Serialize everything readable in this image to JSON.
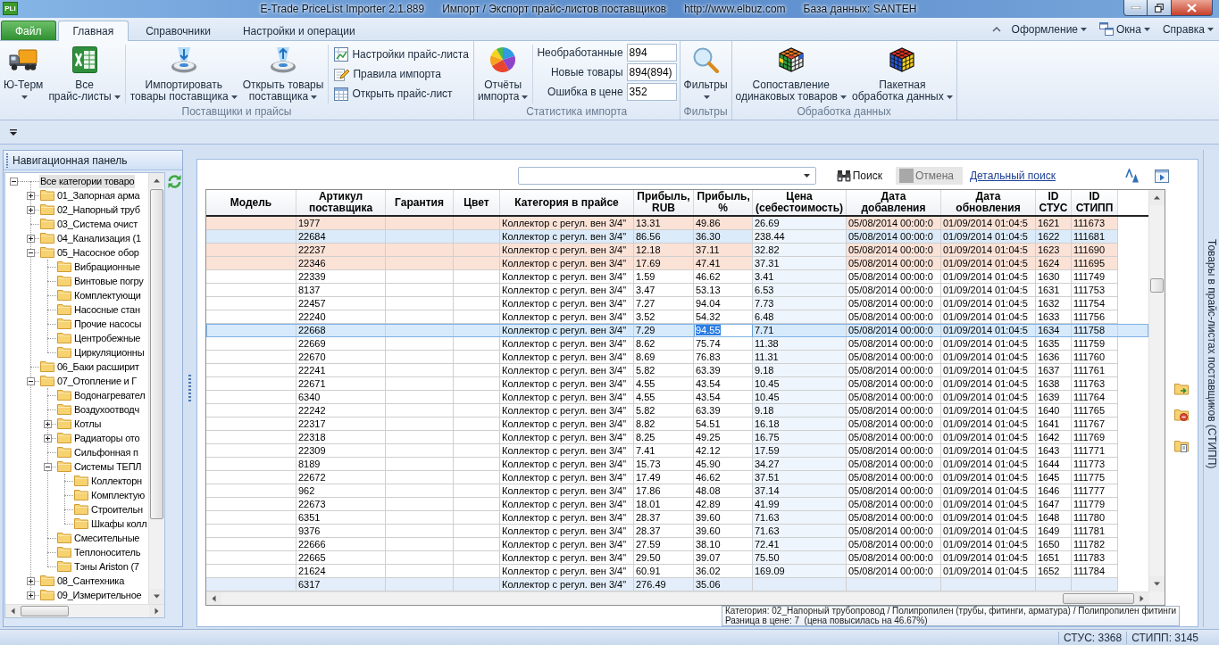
{
  "window": {
    "icon_text": "PLi",
    "title_parts": [
      "E-Trade PriceList Importer 2.1.889",
      "Импорт / Экспорт прайс-листов поставщиков",
      "http://www.elbuz.com",
      "База данных: SANTEH"
    ]
  },
  "ribbon": {
    "file_tab": "Файл",
    "tabs": [
      {
        "label": "Главная",
        "selected": true
      },
      {
        "label": "Справочники",
        "selected": false
      },
      {
        "label": "Настройки и операции",
        "selected": false
      }
    ],
    "menus": [
      {
        "label": "Оформление"
      },
      {
        "label": "Окна"
      },
      {
        "label": "Справка"
      }
    ],
    "groups": [
      {
        "label": "Поставщики и прайсы",
        "sections": [
          {
            "kind": "large",
            "buttons": [
              {
                "lines": [
                  "Ю-Терм"
                ],
                "dropdown": true
              },
              {
                "lines": [
                  "Все",
                  "прайс-листы"
                ],
                "dropdown": true
              }
            ]
          },
          {
            "kind": "large",
            "buttons": [
              {
                "lines": [
                  "Импортировать",
                  "товары поставщика"
                ],
                "dropdown": true
              },
              {
                "lines": [
                  "Открыть товары",
                  "поставщика"
                ],
                "dropdown": true
              }
            ]
          },
          {
            "kind": "small",
            "buttons": [
              "Настройки прайс-листа",
              "Правила импорта",
              "Открыть прайс-лист"
            ]
          }
        ]
      },
      {
        "label": "Статистика импорта",
        "sections": [
          {
            "kind": "large",
            "buttons": [
              {
                "lines": [
                  "Отчёты",
                  "импорта"
                ],
                "dropdown": true
              }
            ]
          },
          {
            "kind": "stats",
            "items": [
              {
                "label": "Необработанные",
                "value": "894"
              },
              {
                "label": "Новые товары",
                "value": "894(894)"
              },
              {
                "label": "Ошибка в цене",
                "value": "352"
              }
            ]
          }
        ]
      },
      {
        "label": "Фильтры",
        "sections": [
          {
            "kind": "large",
            "buttons": [
              {
                "lines": [
                  "Фильтры"
                ],
                "dropdown": true
              }
            ]
          }
        ]
      },
      {
        "label": "Обработка данных",
        "sections": [
          {
            "kind": "large",
            "buttons": [
              {
                "lines": [
                  "Сопоставление",
                  "одинаковых товаров"
                ],
                "dropdown": true
              },
              {
                "lines": [
                  "Пакетная",
                  "обработка данных"
                ],
                "dropdown": true
              }
            ]
          }
        ]
      }
    ]
  },
  "nav_panel": {
    "title": "Навигационная панель",
    "tree": [
      {
        "label": "Все категории товаро",
        "selected": true,
        "expanded": true,
        "children": [
          {
            "label": "01_Запорная арма",
            "selected": false,
            "expanded": false
          },
          {
            "label": "02_Напорный труб",
            "selected": false,
            "expanded": false
          },
          {
            "label": "03_Система очист",
            "selected": false
          },
          {
            "label": "04_Канализация (1",
            "selected": false,
            "expanded": false
          },
          {
            "label": "05_Насосное обор",
            "selected": false,
            "expanded": true,
            "children": [
              {
                "label": "Вибрационные",
                "selected": false
              },
              {
                "label": "Винтовые погру",
                "selected": false
              },
              {
                "label": "Комплектующи",
                "selected": false
              },
              {
                "label": "Насосные стан",
                "selected": false
              },
              {
                "label": "Прочие насосы",
                "selected": false
              },
              {
                "label": "Центробежные",
                "selected": false
              },
              {
                "label": "Циркуляционны",
                "selected": false
              }
            ]
          },
          {
            "label": "06_Баки расширит",
            "selected": false
          },
          {
            "label": "07_Отопление и Г",
            "selected": false,
            "expanded": true,
            "children": [
              {
                "label": "Водонагревател",
                "selected": false
              },
              {
                "label": "Воздухоотводч",
                "selected": false
              },
              {
                "label": "Котлы",
                "selected": false,
                "expanded": false
              },
              {
                "label": "Радиаторы ото",
                "selected": false,
                "expanded": false
              },
              {
                "label": "Сильфонная п",
                "selected": false
              },
              {
                "label": "Системы ТЕПЛ",
                "selected": false,
                "expanded": true,
                "children": [
                  {
                    "label": "Коллекторн",
                    "selected": false
                  },
                  {
                    "label": "Комплектую",
                    "selected": false
                  },
                  {
                    "label": "Строительн",
                    "selected": false
                  },
                  {
                    "label": "Шкафы колл",
                    "selected": false
                  }
                ]
              },
              {
                "label": "Смесительные",
                "selected": false
              },
              {
                "label": "Теплоноситель",
                "selected": false
              },
              {
                "label": "Тэны Ariston (7",
                "selected": false
              }
            ]
          },
          {
            "label": "08_Сантехника",
            "selected": false,
            "expanded": false
          },
          {
            "label": "09_Измерительное",
            "selected": false,
            "expanded": false
          }
        ]
      }
    ]
  },
  "search": {
    "search_button": "Поиск",
    "cancel_button": {
      "label": "Отмена",
      "disabled": true
    },
    "detail_link": "Детальный поиск"
  },
  "table": {
    "columns": [
      {
        "label": "Модель",
        "highlighted": false,
        "focused": false
      },
      {
        "label": "Артикул поставщика",
        "highlighted": false,
        "focused": false
      },
      {
        "label": "Гарантия",
        "highlighted": false,
        "focused": false
      },
      {
        "label": "Цвет",
        "highlighted": false,
        "focused": false
      },
      {
        "label": "Категория в прайсе",
        "highlighted": false,
        "focused": false
      },
      {
        "label": "Прибыль, RUB",
        "highlighted": false,
        "focused": false
      },
      {
        "label": "Прибыль, %",
        "highlighted": false,
        "focused": true
      },
      {
        "label": "Цена (себестоимость)",
        "highlighted": true,
        "focused": false
      },
      {
        "label": "Дата добавления",
        "highlighted": false,
        "focused": false
      },
      {
        "label": "Дата обновления",
        "highlighted": false,
        "focused": false
      },
      {
        "label": "ID СТУС",
        "highlighted": false,
        "focused": false
      },
      {
        "label": "ID СТИПП",
        "highlighted": false,
        "focused": false
      }
    ],
    "rows": [
      {
        "article": "1977",
        "category": "Коллектор с регул. вен 3/4\"",
        "profit_rub": "13.31",
        "profit_pct": "49.86",
        "price": "26.69",
        "date_added": "05/08/2014 00:00:0",
        "date_updated": "01/09/2014 01:04:5",
        "id_stus": "1621",
        "id_stipp": "111673",
        "selected": false,
        "color": "#fbe2d7"
      },
      {
        "article": "22684",
        "category": "Коллектор с регул. вен 3/4\"",
        "profit_rub": "86.56",
        "profit_pct": "36.30",
        "price": "238.44",
        "date_added": "05/08/2014 00:00:0",
        "date_updated": "01/09/2014 01:04:5",
        "id_stus": "1622",
        "id_stipp": "111681",
        "selected": false,
        "color": "#dcebfa"
      },
      {
        "article": "22237",
        "category": "Коллектор с регул. вен 3/4\"",
        "profit_rub": "12.18",
        "profit_pct": "37.11",
        "price": "32.82",
        "date_added": "05/08/2014 00:00:0",
        "date_updated": "01/09/2014 01:04:5",
        "id_stus": "1623",
        "id_stipp": "111690",
        "selected": false,
        "color": "#fbe2d7"
      },
      {
        "article": "22346",
        "category": "Коллектор с регул. вен 3/4\"",
        "profit_rub": "17.69",
        "profit_pct": "47.41",
        "price": "37.31",
        "date_added": "05/08/2014 00:00:0",
        "date_updated": "01/09/2014 01:04:5",
        "id_stus": "1624",
        "id_stipp": "111695",
        "selected": false,
        "color": "#fbe2d7"
      },
      {
        "article": "22339",
        "category": "Коллектор с регул. вен 3/4\"",
        "profit_rub": "1.59",
        "profit_pct": "46.62",
        "price": "3.41",
        "date_added": "05/08/2014 00:00:0",
        "date_updated": "01/09/2014 01:04:5",
        "id_stus": "1630",
        "id_stipp": "111749",
        "selected": false
      },
      {
        "article": "8137",
        "category": "Коллектор с регул. вен 3/4\"",
        "profit_rub": "3.47",
        "profit_pct": "53.13",
        "price": "6.53",
        "date_added": "05/08/2014 00:00:0",
        "date_updated": "01/09/2014 01:04:5",
        "id_stus": "1631",
        "id_stipp": "111753",
        "selected": false
      },
      {
        "article": "22457",
        "category": "Коллектор с регул. вен 3/4\"",
        "profit_rub": "7.27",
        "profit_pct": "94.04",
        "price": "7.73",
        "date_added": "05/08/2014 00:00:0",
        "date_updated": "01/09/2014 01:04:5",
        "id_stus": "1632",
        "id_stipp": "111754",
        "selected": false
      },
      {
        "article": "22240",
        "category": "Коллектор с регул. вен 3/4\"",
        "profit_rub": "3.52",
        "profit_pct": "54.32",
        "price": "6.48",
        "date_added": "05/08/2014 00:00:0",
        "date_updated": "01/09/2014 01:04:5",
        "id_stus": "1633",
        "id_stipp": "111756",
        "selected": false
      },
      {
        "article": "22668",
        "category": "Коллектор с регул. вен 3/4\"",
        "profit_rub": "7.29",
        "profit_pct": "94.55",
        "price": "7.71",
        "date_added": "05/08/2014 00:00:0",
        "date_updated": "01/09/2014 01:04:5",
        "id_stus": "1634",
        "id_stipp": "111758",
        "selected": true
      },
      {
        "article": "22669",
        "category": "Коллектор с регул. вен 3/4\"",
        "profit_rub": "8.62",
        "profit_pct": "75.74",
        "price": "11.38",
        "date_added": "05/08/2014 00:00:0",
        "date_updated": "01/09/2014 01:04:5",
        "id_stus": "1635",
        "id_stipp": "111759",
        "selected": false
      },
      {
        "article": "22670",
        "category": "Коллектор с регул. вен 3/4\"",
        "profit_rub": "8.69",
        "profit_pct": "76.83",
        "price": "11.31",
        "date_added": "05/08/2014 00:00:0",
        "date_updated": "01/09/2014 01:04:5",
        "id_stus": "1636",
        "id_stipp": "111760",
        "selected": false
      },
      {
        "article": "22241",
        "category": "Коллектор с регул. вен 3/4\"",
        "profit_rub": "5.82",
        "profit_pct": "63.39",
        "price": "9.18",
        "date_added": "05/08/2014 00:00:0",
        "date_updated": "01/09/2014 01:04:5",
        "id_stus": "1637",
        "id_stipp": "111761",
        "selected": false
      },
      {
        "article": "22671",
        "category": "Коллектор с регул. вен 3/4\"",
        "profit_rub": "4.55",
        "profit_pct": "43.54",
        "price": "10.45",
        "date_added": "05/08/2014 00:00:0",
        "date_updated": "01/09/2014 01:04:5",
        "id_stus": "1638",
        "id_stipp": "111763",
        "selected": false
      },
      {
        "article": "6340",
        "category": "Коллектор с регул. вен 3/4\"",
        "profit_rub": "4.55",
        "profit_pct": "43.54",
        "price": "10.45",
        "date_added": "05/08/2014 00:00:0",
        "date_updated": "01/09/2014 01:04:5",
        "id_stus": "1639",
        "id_stipp": "111764",
        "selected": false
      },
      {
        "article": "22242",
        "category": "Коллектор с регул. вен 3/4\"",
        "profit_rub": "5.82",
        "profit_pct": "63.39",
        "price": "9.18",
        "date_added": "05/08/2014 00:00:0",
        "date_updated": "01/09/2014 01:04:5",
        "id_stus": "1640",
        "id_stipp": "111765",
        "selected": false
      },
      {
        "article": "22317",
        "category": "Коллектор с регул. вен 3/4\"",
        "profit_rub": "8.82",
        "profit_pct": "54.51",
        "price": "16.18",
        "date_added": "05/08/2014 00:00:0",
        "date_updated": "01/09/2014 01:04:5",
        "id_stus": "1641",
        "id_stipp": "111767",
        "selected": false
      },
      {
        "article": "22318",
        "category": "Коллектор с регул. вен 3/4\"",
        "profit_rub": "8.25",
        "profit_pct": "49.25",
        "price": "16.75",
        "date_added": "05/08/2014 00:00:0",
        "date_updated": "01/09/2014 01:04:5",
        "id_stus": "1642",
        "id_stipp": "111769",
        "selected": false
      },
      {
        "article": "22309",
        "category": "Коллектор с регул. вен 3/4\"",
        "profit_rub": "7.41",
        "profit_pct": "42.12",
        "price": "17.59",
        "date_added": "05/08/2014 00:00:0",
        "date_updated": "01/09/2014 01:04:5",
        "id_stus": "1643",
        "id_stipp": "111771",
        "selected": false
      },
      {
        "article": "8189",
        "category": "Коллектор с регул. вен 3/4\"",
        "profit_rub": "15.73",
        "profit_pct": "45.90",
        "price": "34.27",
        "date_added": "05/08/2014 00:00:0",
        "date_updated": "01/09/2014 01:04:5",
        "id_stus": "1644",
        "id_stipp": "111773",
        "selected": false
      },
      {
        "article": "22672",
        "category": "Коллектор с регул. вен 3/4\"",
        "profit_rub": "17.49",
        "profit_pct": "46.62",
        "price": "37.51",
        "date_added": "05/08/2014 00:00:0",
        "date_updated": "01/09/2014 01:04:5",
        "id_stus": "1645",
        "id_stipp": "111775",
        "selected": false
      },
      {
        "article": "962",
        "category": "Коллектор с регул. вен 3/4\"",
        "profit_rub": "17.86",
        "profit_pct": "48.08",
        "price": "37.14",
        "date_added": "05/08/2014 00:00:0",
        "date_updated": "01/09/2014 01:04:5",
        "id_stus": "1646",
        "id_stipp": "111777",
        "selected": false
      },
      {
        "article": "22673",
        "category": "Коллектор с регул. вен 3/4\"",
        "profit_rub": "18.01",
        "profit_pct": "42.89",
        "price": "41.99",
        "date_added": "05/08/2014 00:00:0",
        "date_updated": "01/09/2014 01:04:5",
        "id_stus": "1647",
        "id_stipp": "111779",
        "selected": false
      },
      {
        "article": "6351",
        "category": "Коллектор с регул. вен 3/4\"",
        "profit_rub": "28.37",
        "profit_pct": "39.60",
        "price": "71.63",
        "date_added": "05/08/2014 00:00:0",
        "date_updated": "01/09/2014 01:04:5",
        "id_stus": "1648",
        "id_stipp": "111780",
        "selected": false
      },
      {
        "article": "9376",
        "category": "Коллектор с регул. вен 3/4\"",
        "profit_rub": "28.37",
        "profit_pct": "39.60",
        "price": "71.63",
        "date_added": "05/08/2014 00:00:0",
        "date_updated": "01/09/2014 01:04:5",
        "id_stus": "1649",
        "id_stipp": "111781",
        "selected": false
      },
      {
        "article": "22666",
        "category": "Коллектор с регул. вен 3/4\"",
        "profit_rub": "27.59",
        "profit_pct": "38.10",
        "price": "72.41",
        "date_added": "05/08/2014 00:00:0",
        "date_updated": "01/09/2014 01:04:5",
        "id_stus": "1650",
        "id_stipp": "111782",
        "selected": false
      },
      {
        "article": "22665",
        "category": "Коллектор с регул. вен 3/4\"",
        "profit_rub": "29.50",
        "profit_pct": "39.07",
        "price": "75.50",
        "date_added": "05/08/2014 00:00:0",
        "date_updated": "01/09/2014 01:04:5",
        "id_stus": "1651",
        "id_stipp": "111783",
        "selected": false
      },
      {
        "article": "21624",
        "category": "Коллектор с регул. вен 3/4\"",
        "profit_rub": "60.91",
        "profit_pct": "36.02",
        "price": "169.09",
        "date_added": "05/08/2014 00:00:0",
        "date_updated": "01/09/2014 01:04:5",
        "id_stus": "1652",
        "id_stipp": "111784",
        "selected": false
      },
      {
        "article": "6317",
        "category": "Коллектор с регул. вен 3/4\"",
        "profit_rub": "276.49",
        "profit_pct": "35.06",
        "selected": false,
        "color": "#e3eefa"
      }
    ]
  },
  "tooltip": {
    "lines": [
      "Категория: 02_Напорный трубопровод / Полипропилен (трубы, фитинги, арматура) / Полипропилен фитинги",
      "Разница в цене: 7  (цена повысилась на 46.67%)"
    ]
  },
  "side_tab": {
    "label": "Товары в прайс-листах поставщиков (СТИПП)"
  },
  "status_bar": {
    "items": [
      "СТУС: 3368",
      "СТИПП: 3145"
    ]
  }
}
